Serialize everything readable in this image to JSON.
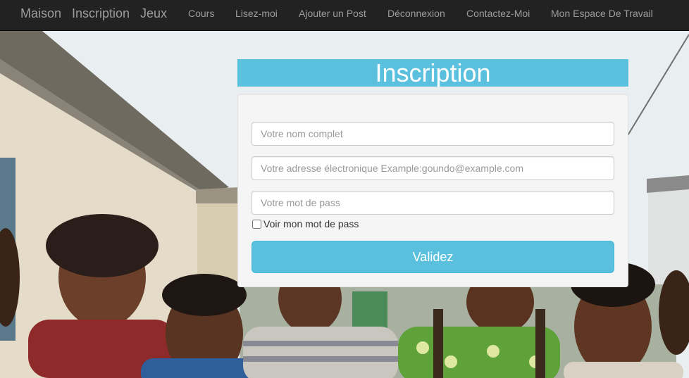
{
  "navbar": {
    "brand_items": [
      {
        "label": "Maison"
      },
      {
        "label": "Inscription"
      },
      {
        "label": "Jeux"
      }
    ],
    "links": [
      {
        "label": "Cours"
      },
      {
        "label": "Lisez-moi"
      },
      {
        "label": "Ajouter un Post"
      },
      {
        "label": "Déconnexion"
      },
      {
        "label": "Contactez-Moi"
      },
      {
        "label": "Mon Espace De Travail"
      }
    ]
  },
  "form": {
    "title": "Inscription",
    "name_placeholder": "Votre nom complet",
    "email_placeholder": "Votre adresse électronique Example:goundo@example.com",
    "password_placeholder": "Votre mot de pass",
    "show_password_label": "Voir mon mot de pass",
    "show_password_checked": false,
    "submit_label": "Validez"
  },
  "colors": {
    "navbar_bg": "#222222",
    "nav_text": "#9d9d9d",
    "accent": "#5bc0de",
    "panel_bg": "#f5f5f5"
  }
}
